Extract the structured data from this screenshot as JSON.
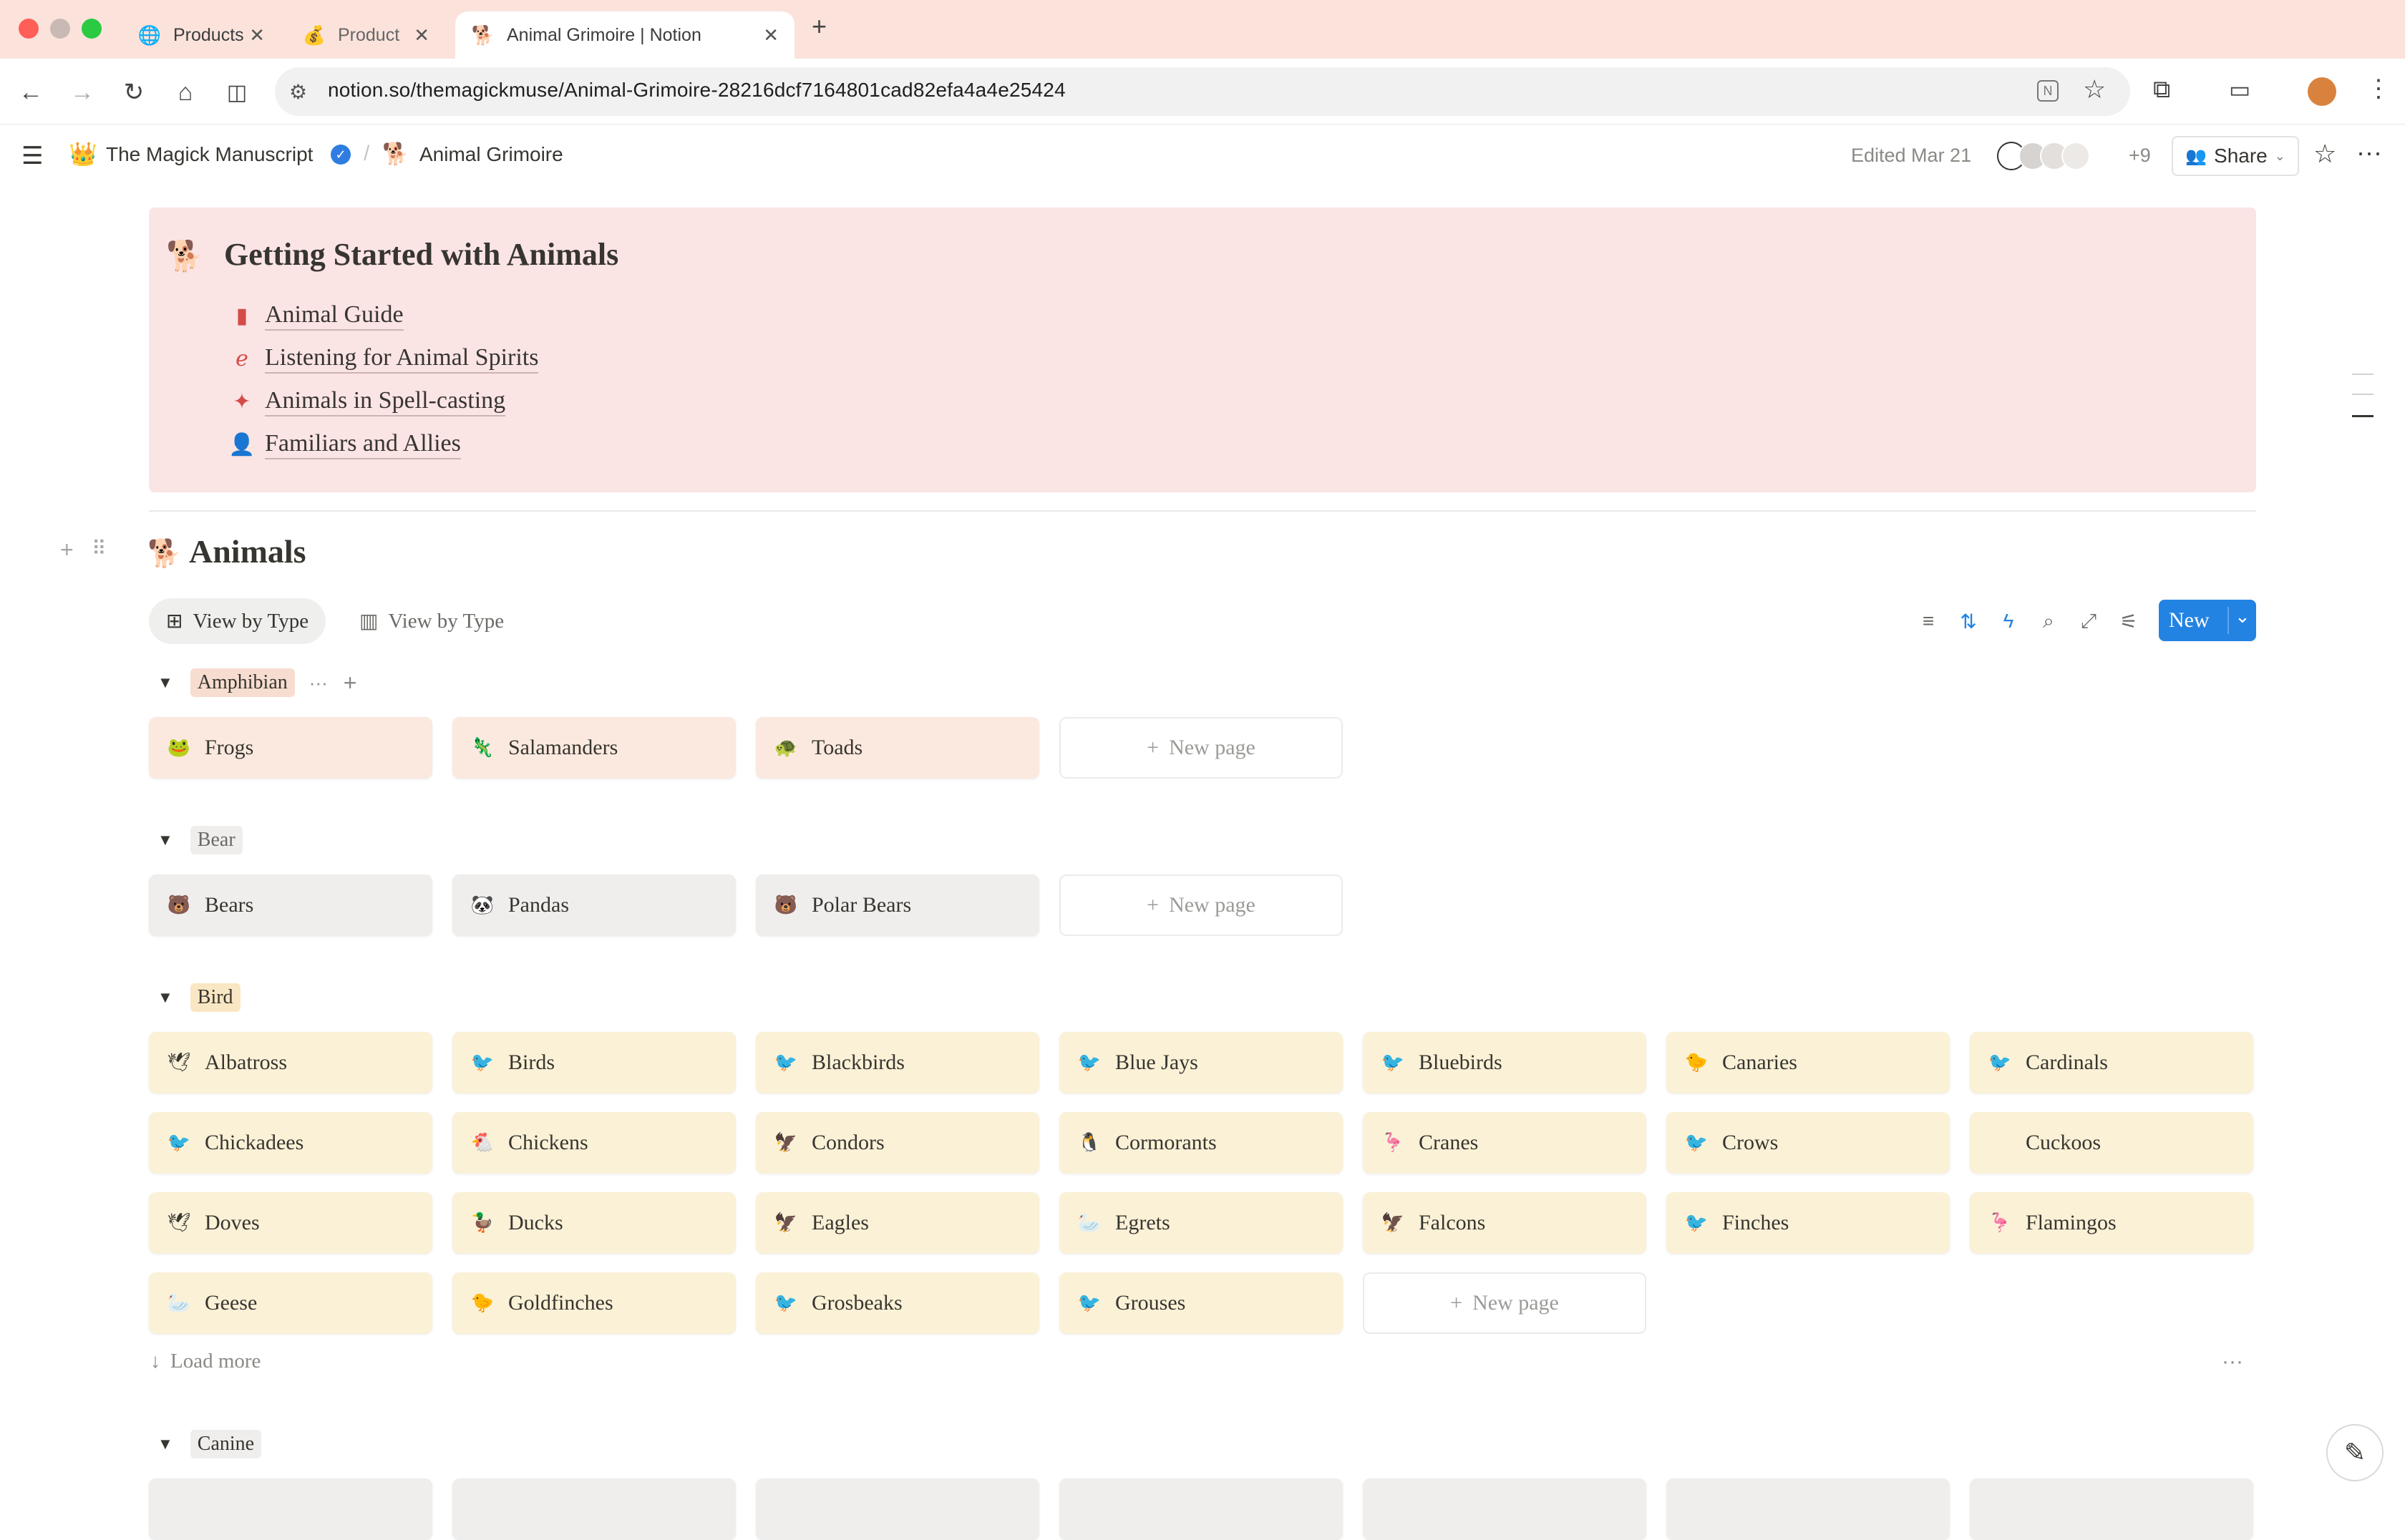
{
  "browser": {
    "tabs": [
      {
        "label": "Products",
        "icon": "globe-icon"
      },
      {
        "label": "Product",
        "icon": "money-bag-icon"
      },
      {
        "label": "Animal Grimoire | Notion",
        "icon": "red-dog-icon"
      }
    ],
    "url": "notion.so/themagickmuse/Animal-Grimoire-28216dcf7164801cad82efa4a4e25424"
  },
  "header": {
    "workspace": "The Magick Manuscript",
    "page": "Animal Grimoire",
    "edited": "Edited Mar 21",
    "collaborators_extra": "+9",
    "share_label": "Share"
  },
  "callout": {
    "title": "Getting Started with Animals",
    "links": [
      {
        "label": "Animal Guide",
        "icon": "book-icon"
      },
      {
        "label": "Listening for Animal Spirits",
        "icon": "ear-icon"
      },
      {
        "label": "Animals in Spell-casting",
        "icon": "magic-wand-icon"
      },
      {
        "label": "Familiars and Allies",
        "icon": "add-person-icon"
      }
    ]
  },
  "database": {
    "title": "Animals",
    "views": [
      "View by Type",
      "View by Type"
    ],
    "new_label": "New",
    "new_page_label": "New page",
    "load_more_label": "Load more",
    "groups": [
      {
        "name": "Amphibian",
        "items": [
          {
            "label": "Frogs",
            "emoji": "🐸"
          },
          {
            "label": "Salamanders",
            "emoji": "🦎"
          },
          {
            "label": "Toads",
            "emoji": "🐢"
          }
        ]
      },
      {
        "name": "Bear",
        "items": [
          {
            "label": "Bears",
            "emoji": "🐻"
          },
          {
            "label": "Pandas",
            "emoji": "🐼"
          },
          {
            "label": "Polar Bears",
            "emoji": "🐻"
          }
        ]
      },
      {
        "name": "Bird",
        "items": [
          {
            "label": "Albatross",
            "emoji": "🕊"
          },
          {
            "label": "Birds",
            "emoji": "🐦"
          },
          {
            "label": "Blackbirds",
            "emoji": "🐦"
          },
          {
            "label": "Blue Jays",
            "emoji": "🐦"
          },
          {
            "label": "Bluebirds",
            "emoji": "🐦"
          },
          {
            "label": "Canaries",
            "emoji": "🐤"
          },
          {
            "label": "Cardinals",
            "emoji": "🐦"
          },
          {
            "label": "Chickadees",
            "emoji": "🐦"
          },
          {
            "label": "Chickens",
            "emoji": "🐔"
          },
          {
            "label": "Condors",
            "emoji": "🦅"
          },
          {
            "label": "Cormorants",
            "emoji": "🐧"
          },
          {
            "label": "Cranes",
            "emoji": "🦩"
          },
          {
            "label": "Crows",
            "emoji": "🐦"
          },
          {
            "label": "Cuckoos",
            "emoji": ""
          },
          {
            "label": "Doves",
            "emoji": "🕊"
          },
          {
            "label": "Ducks",
            "emoji": "🦆"
          },
          {
            "label": "Eagles",
            "emoji": "🦅"
          },
          {
            "label": "Egrets",
            "emoji": "🦢"
          },
          {
            "label": "Falcons",
            "emoji": "🦅"
          },
          {
            "label": "Finches",
            "emoji": "🐦"
          },
          {
            "label": "Flamingos",
            "emoji": "🦩"
          },
          {
            "label": "Geese",
            "emoji": "🦢"
          },
          {
            "label": "Goldfinches",
            "emoji": "🐤"
          },
          {
            "label": "Grosbeaks",
            "emoji": "🐦"
          },
          {
            "label": "Grouses",
            "emoji": "🐦"
          }
        ]
      },
      {
        "name": "Canine",
        "items": []
      }
    ]
  }
}
